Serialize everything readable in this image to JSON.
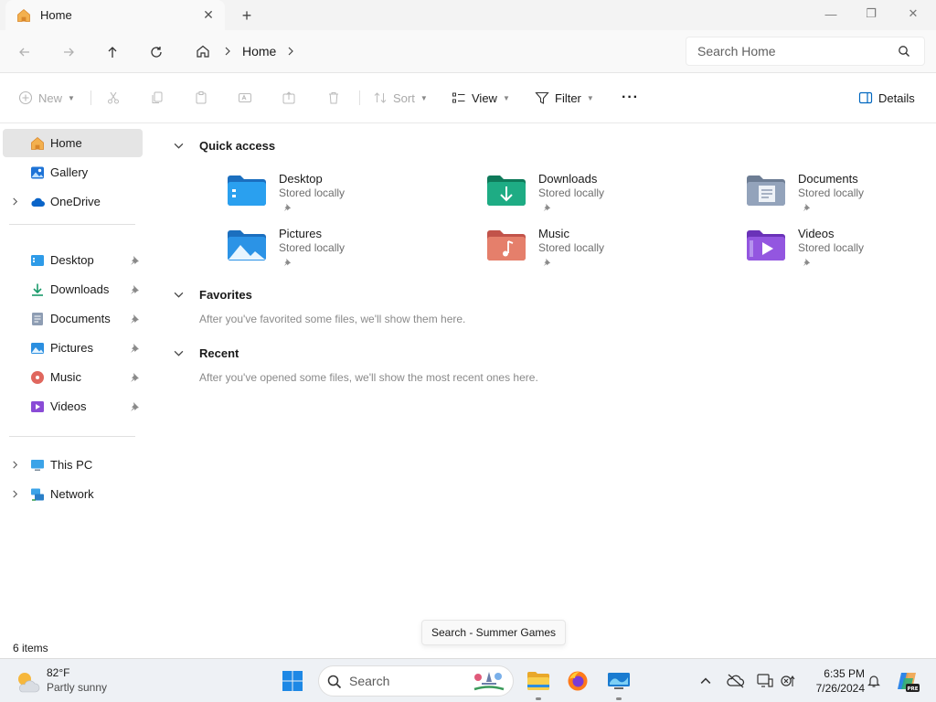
{
  "window": {
    "tab_title": "Home",
    "tab_close": "✕",
    "new_tab": "+",
    "minimize": "—",
    "maximize": "❐",
    "close": "✕"
  },
  "address": {
    "crumbs": [
      "Home"
    ],
    "search_placeholder": "Search Home"
  },
  "commands": {
    "new_label": "New",
    "sort_label": "Sort",
    "view_label": "View",
    "filter_label": "Filter",
    "more_label": "···",
    "details_label": "Details"
  },
  "sidebar": {
    "top": [
      {
        "label": "Home",
        "icon": "home-icon",
        "selected": true
      },
      {
        "label": "Gallery",
        "icon": "gallery-icon"
      },
      {
        "label": "OneDrive",
        "icon": "onedrive-icon",
        "expandable": true
      }
    ],
    "pinned": [
      {
        "label": "Desktop",
        "icon": "desktop-folder-icon"
      },
      {
        "label": "Downloads",
        "icon": "downloads-folder-icon"
      },
      {
        "label": "Documents",
        "icon": "documents-folder-icon"
      },
      {
        "label": "Pictures",
        "icon": "pictures-folder-icon"
      },
      {
        "label": "Music",
        "icon": "music-folder-icon"
      },
      {
        "label": "Videos",
        "icon": "videos-folder-icon"
      }
    ],
    "bottom": [
      {
        "label": "This PC",
        "icon": "this-pc-icon"
      },
      {
        "label": "Network",
        "icon": "network-icon"
      }
    ]
  },
  "main": {
    "quick_access": {
      "title": "Quick access",
      "items": [
        {
          "name": "Desktop",
          "status": "Stored locally"
        },
        {
          "name": "Downloads",
          "status": "Stored locally"
        },
        {
          "name": "Documents",
          "status": "Stored locally"
        },
        {
          "name": "Pictures",
          "status": "Stored locally"
        },
        {
          "name": "Music",
          "status": "Stored locally"
        },
        {
          "name": "Videos",
          "status": "Stored locally"
        }
      ]
    },
    "favorites": {
      "title": "Favorites",
      "message": "After you've favorited some files, we'll show them here."
    },
    "recent": {
      "title": "Recent",
      "message": "After you've opened some files, we'll show the most recent ones here."
    }
  },
  "status": {
    "item_count": "6 items"
  },
  "tooltip": {
    "text": "Search - Summer Games"
  },
  "taskbar": {
    "weather_temp": "82°F",
    "weather_condition": "Partly sunny",
    "search_label": "Search",
    "time": "6:35 PM",
    "date": "7/26/2024",
    "copilot_badge": "PRE"
  },
  "colors": {
    "accent": "#0067c0",
    "selected_bg": "#e5e5e5",
    "taskbar_bg": "#eef1f5"
  }
}
